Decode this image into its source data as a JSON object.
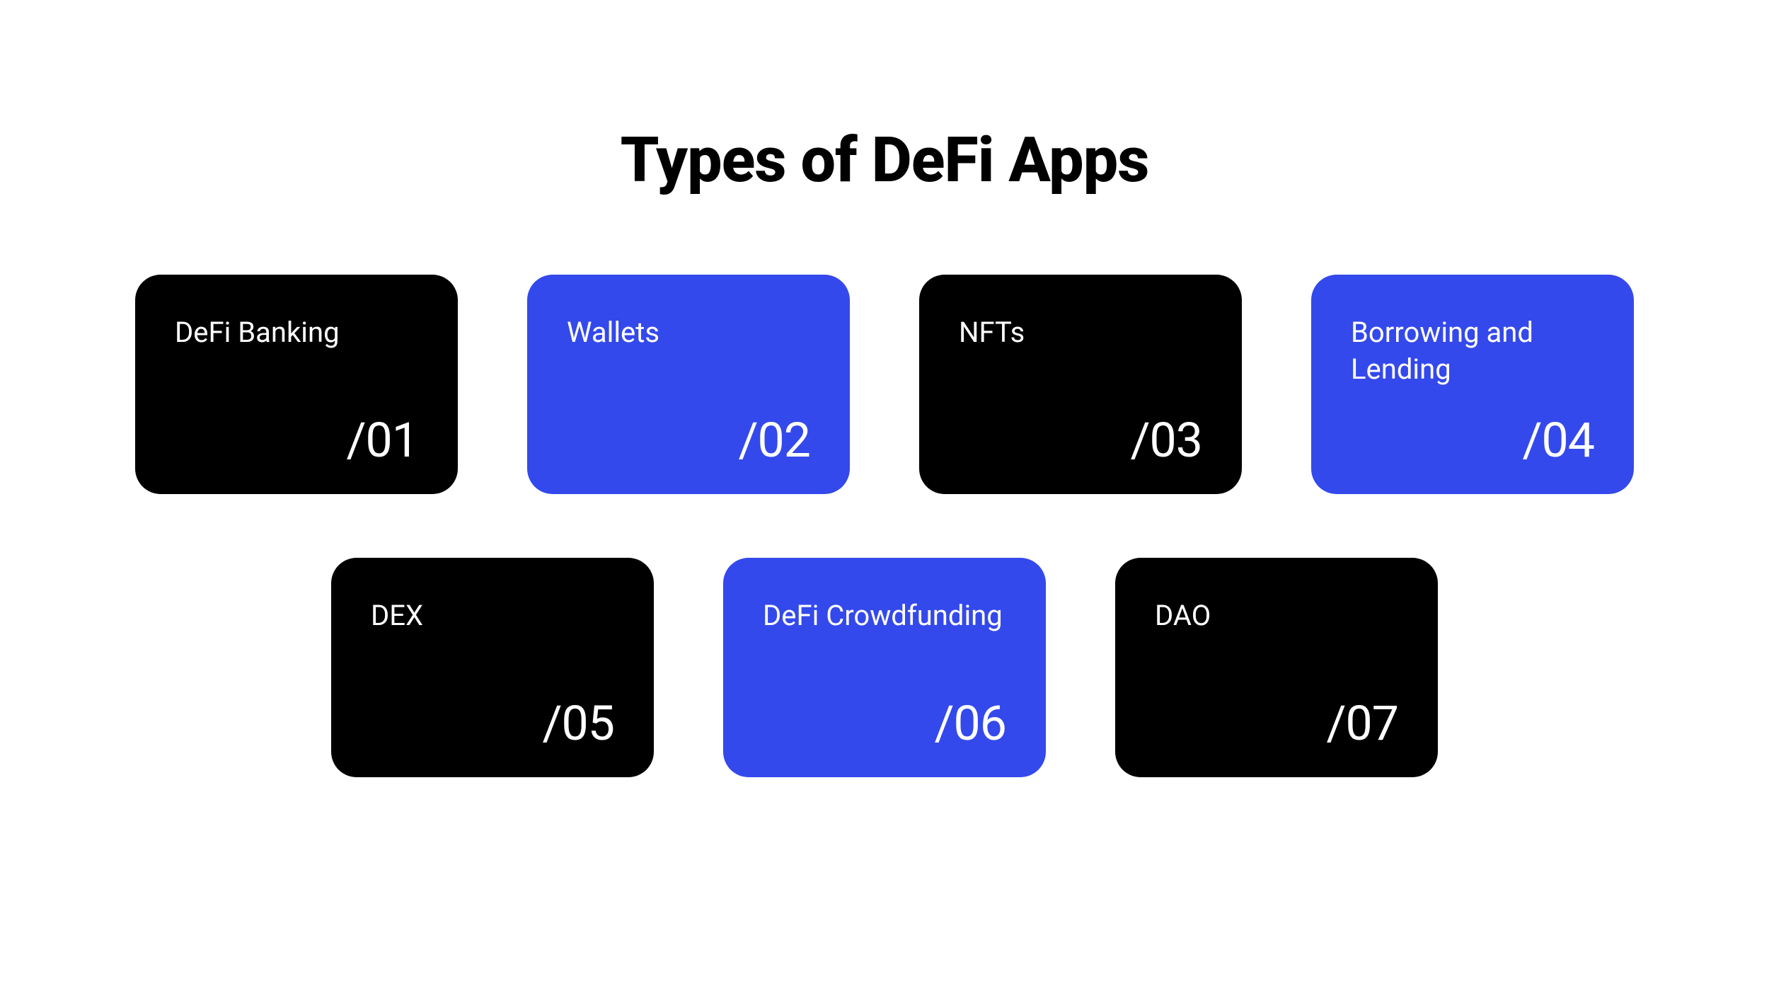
{
  "title": "Types of DeFi Apps",
  "cards": [
    {
      "label": "DeFi Banking",
      "number": "/01",
      "color": "black"
    },
    {
      "label": "Wallets",
      "number": "/02",
      "color": "blue"
    },
    {
      "label": "NFTs",
      "number": "/03",
      "color": "black"
    },
    {
      "label": "Borrowing and Lending",
      "number": "/04",
      "color": "blue"
    },
    {
      "label": "DEX",
      "number": "/05",
      "color": "black"
    },
    {
      "label": "DeFi Crowdfunding",
      "number": "/06",
      "color": "blue"
    },
    {
      "label": "DAO",
      "number": "/07",
      "color": "black"
    }
  ]
}
